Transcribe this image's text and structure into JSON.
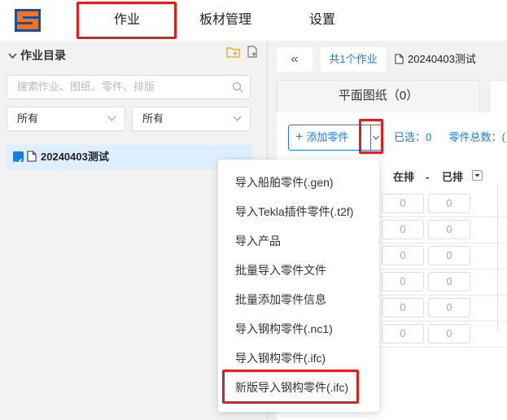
{
  "nav": {
    "items": [
      {
        "label": "作业",
        "highlighted": true
      },
      {
        "label": "板材管理"
      },
      {
        "label": "设置"
      }
    ]
  },
  "sidebar": {
    "title": "作业目录",
    "search_placeholder": "搜索作业、图纸、零件、排版",
    "filter1": "所有",
    "filter2": "所有",
    "tree": [
      {
        "label": "20240403测试",
        "checked": true
      }
    ]
  },
  "header": {
    "collapse": "«",
    "job_count": "共1个作业",
    "job_name": "20240403测试"
  },
  "tabs": [
    {
      "label": "平面图纸（0）"
    }
  ],
  "toolbar": {
    "add_parts": "添加零件",
    "selected": "已选：0",
    "total": "零件总数：("
  },
  "table": {
    "headers": [
      "在排",
      "-",
      "已排"
    ],
    "rows": [
      [
        "0",
        "0"
      ],
      [
        "0",
        "0"
      ],
      [
        "0",
        "0"
      ],
      [
        "0",
        "0"
      ],
      [
        "0",
        "0"
      ],
      [
        "0",
        "0"
      ]
    ]
  },
  "menu": {
    "items": [
      {
        "label": "导入船舶零件(.gen)"
      },
      {
        "label": "导入Tekla插件零件(.t2f)"
      },
      {
        "label": "导入产品"
      },
      {
        "label": "批量导入零件文件"
      },
      {
        "label": "批量添加零件信息"
      },
      {
        "label": "导入钢构零件(.nc1)"
      },
      {
        "label": "导入钢构零件(.ifc)"
      },
      {
        "label": "新版导入钢构零件(.ifc)",
        "highlighted": true
      }
    ]
  },
  "colors": {
    "accent": "#1e7be0",
    "highlight_box": "#e02020",
    "selected_row": "#ddeeff"
  }
}
